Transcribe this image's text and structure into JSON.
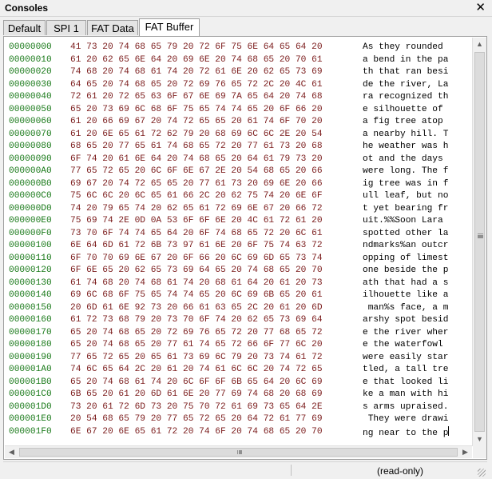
{
  "window": {
    "title": "Consoles",
    "close_glyph": "✕"
  },
  "tabs": [
    {
      "label": "Default"
    },
    {
      "label": "SPI 1"
    },
    {
      "label": "FAT Data"
    },
    {
      "label": "FAT Buffer",
      "active": true
    }
  ],
  "dump": {
    "rows": [
      {
        "addr": "00000000",
        "hex": "41 73 20 74 68 65 79 20 72 6F 75 6E 64 65 64 20",
        "ascii": "As they rounded "
      },
      {
        "addr": "00000010",
        "hex": "61 20 62 65 6E 64 20 69 6E 20 74 68 65 20 70 61",
        "ascii": "a bend in the pa"
      },
      {
        "addr": "00000020",
        "hex": "74 68 20 74 68 61 74 20 72 61 6E 20 62 65 73 69",
        "ascii": "th that ran besi"
      },
      {
        "addr": "00000030",
        "hex": "64 65 20 74 68 65 20 72 69 76 65 72 2C 20 4C 61",
        "ascii": "de the river, La"
      },
      {
        "addr": "00000040",
        "hex": "72 61 20 72 65 63 6F 67 6E 69 7A 65 64 20 74 68",
        "ascii": "ra recognized th"
      },
      {
        "addr": "00000050",
        "hex": "65 20 73 69 6C 68 6F 75 65 74 74 65 20 6F 66 20",
        "ascii": "e silhouette of "
      },
      {
        "addr": "00000060",
        "hex": "61 20 66 69 67 20 74 72 65 65 20 61 74 6F 70 20",
        "ascii": "a fig tree atop "
      },
      {
        "addr": "00000070",
        "hex": "61 20 6E 65 61 72 62 79 20 68 69 6C 6C 2E 20 54",
        "ascii": "a nearby hill. T"
      },
      {
        "addr": "00000080",
        "hex": "68 65 20 77 65 61 74 68 65 72 20 77 61 73 20 68",
        "ascii": "he weather was h"
      },
      {
        "addr": "00000090",
        "hex": "6F 74 20 61 6E 64 20 74 68 65 20 64 61 79 73 20",
        "ascii": "ot and the days "
      },
      {
        "addr": "000000A0",
        "hex": "77 65 72 65 20 6C 6F 6E 67 2E 20 54 68 65 20 66",
        "ascii": "were long. The f"
      },
      {
        "addr": "000000B0",
        "hex": "69 67 20 74 72 65 65 20 77 61 73 20 69 6E 20 66",
        "ascii": "ig tree was in f"
      },
      {
        "addr": "000000C0",
        "hex": "75 6C 6C 20 6C 65 61 66 2C 20 62 75 74 20 6E 6F",
        "ascii": "ull leaf, but no"
      },
      {
        "addr": "000000D0",
        "hex": "74 20 79 65 74 20 62 65 61 72 69 6E 67 20 66 72",
        "ascii": "t yet bearing fr"
      },
      {
        "addr": "000000E0",
        "hex": "75 69 74 2E 0D 0A 53 6F 6F 6E 20 4C 61 72 61 20",
        "ascii": "uit.%%Soon Lara "
      },
      {
        "addr": "000000F0",
        "hex": "73 70 6F 74 74 65 64 20 6F 74 68 65 72 20 6C 61",
        "ascii": "spotted other la"
      },
      {
        "addr": "00000100",
        "hex": "6E 64 6D 61 72 6B 73 97 61 6E 20 6F 75 74 63 72",
        "ascii": "ndmarks%an outcr"
      },
      {
        "addr": "00000110",
        "hex": "6F 70 70 69 6E 67 20 6F 66 20 6C 69 6D 65 73 74",
        "ascii": "opping of limest"
      },
      {
        "addr": "00000120",
        "hex": "6F 6E 65 20 62 65 73 69 64 65 20 74 68 65 20 70",
        "ascii": "one beside the p"
      },
      {
        "addr": "00000130",
        "hex": "61 74 68 20 74 68 61 74 20 68 61 64 20 61 20 73",
        "ascii": "ath that had a s"
      },
      {
        "addr": "00000140",
        "hex": "69 6C 68 6F 75 65 74 74 65 20 6C 69 6B 65 20 61",
        "ascii": "ilhouette like a"
      },
      {
        "addr": "00000150",
        "hex": "20 6D 61 6E 92 73 20 66 61 63 65 2C 20 61 20 6D",
        "ascii": " man%s face, a m"
      },
      {
        "addr": "00000160",
        "hex": "61 72 73 68 79 20 73 70 6F 74 20 62 65 73 69 64",
        "ascii": "arshy spot besid"
      },
      {
        "addr": "00000170",
        "hex": "65 20 74 68 65 20 72 69 76 65 72 20 77 68 65 72",
        "ascii": "e the river wher"
      },
      {
        "addr": "00000180",
        "hex": "65 20 74 68 65 20 77 61 74 65 72 66 6F 77 6C 20",
        "ascii": "e the waterfowl "
      },
      {
        "addr": "00000190",
        "hex": "77 65 72 65 20 65 61 73 69 6C 79 20 73 74 61 72",
        "ascii": "were easily star"
      },
      {
        "addr": "000001A0",
        "hex": "74 6C 65 64 2C 20 61 20 74 61 6C 6C 20 74 72 65",
        "ascii": "tled, a tall tre"
      },
      {
        "addr": "000001B0",
        "hex": "65 20 74 68 61 74 20 6C 6F 6F 6B 65 64 20 6C 69",
        "ascii": "e that looked li"
      },
      {
        "addr": "000001C0",
        "hex": "6B 65 20 61 20 6D 61 6E 20 77 69 74 68 20 68 69",
        "ascii": "ke a man with hi"
      },
      {
        "addr": "000001D0",
        "hex": "73 20 61 72 6D 73 20 75 70 72 61 69 73 65 64 2E",
        "ascii": "s arms upraised."
      },
      {
        "addr": "000001E0",
        "hex": "20 54 68 65 79 20 77 65 72 65 20 64 72 61 77 69",
        "ascii": " They were drawi"
      },
      {
        "addr": "000001F0",
        "hex": "6E 67 20 6E 65 61 72 20 74 6F 20 74 68 65 20 70",
        "ascii": "ng near to the p"
      }
    ]
  },
  "scrollbar": {
    "up_glyph": "▲",
    "down_glyph": "▼",
    "left_glyph": "◀",
    "right_glyph": "▶"
  },
  "status": {
    "mode": "(read-only)"
  },
  "colors": {
    "address": "#1a7a1a",
    "hex": "#7a1a1a",
    "ascii": "#000000"
  }
}
